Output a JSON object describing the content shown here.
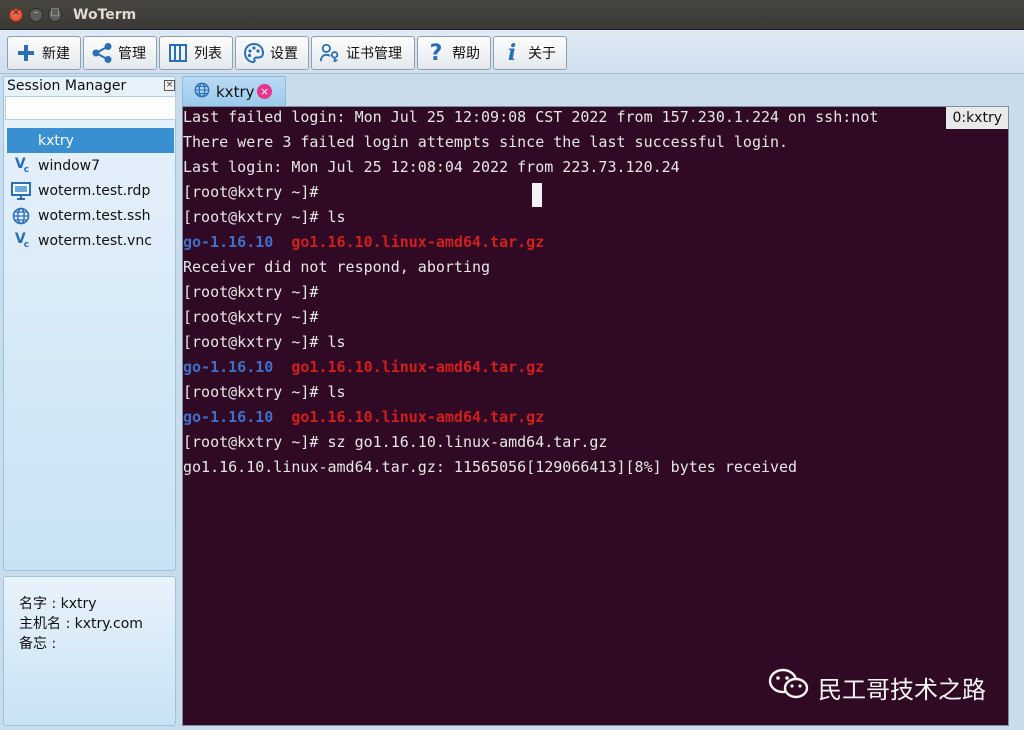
{
  "window": {
    "title": "WoTerm"
  },
  "toolbar": {
    "buttons": [
      {
        "label": "新建",
        "icon": "plus-icon"
      },
      {
        "label": "管理",
        "icon": "share-icon"
      },
      {
        "label": "列表",
        "icon": "list-panel-icon"
      },
      {
        "label": "设置",
        "icon": "palette-icon"
      },
      {
        "label": "证书管理",
        "icon": "key-user-icon"
      },
      {
        "label": "帮助",
        "icon": "question-icon"
      },
      {
        "label": "关于",
        "icon": "info-icon"
      }
    ]
  },
  "session_manager": {
    "title": "Session Manager",
    "search_value": "",
    "items": [
      {
        "label": "kxtry",
        "icon": "none",
        "selected": true
      },
      {
        "label": "window7",
        "icon": "vnc-icon"
      },
      {
        "label": "woterm.test.rdp",
        "icon": "rdp-monitor-icon"
      },
      {
        "label": "woterm.test.ssh",
        "icon": "globe-icon"
      },
      {
        "label": "woterm.test.vnc",
        "icon": "vnc-icon"
      }
    ]
  },
  "info": {
    "name_label": "名字 : kxtry",
    "host_label": "主机名 : kxtry.com",
    "note_label": "备忘 :"
  },
  "tab": {
    "label": "kxtry"
  },
  "terminal": {
    "tag": "0:kxtry",
    "lines": [
      {
        "text": "Last failed login: Mon Jul 25 12:09:08 CST 2022 from 157.230.1.224 on ssh:not"
      },
      {
        "text": "There were 3 failed login attempts since the last successful login."
      },
      {
        "text": "Last login: Mon Jul 25 12:08:04 2022 from 223.73.120.24"
      },
      {
        "text": "[root@kxtry ~]#"
      },
      {
        "text": "[root@kxtry ~]# ls"
      },
      {
        "dir": "go-1.16.10",
        "file": "go1.16.10.linux-amd64.tar.gz"
      },
      {
        "text": "Receiver did not respond, aborting"
      },
      {
        "text": "[root@kxtry ~]#"
      },
      {
        "text": "[root@kxtry ~]#"
      },
      {
        "text": "[root@kxtry ~]# ls"
      },
      {
        "dir": "go-1.16.10",
        "file": "go1.16.10.linux-amd64.tar.gz"
      },
      {
        "text": "[root@kxtry ~]# ls"
      },
      {
        "dir": "go-1.16.10",
        "file": "go1.16.10.linux-amd64.tar.gz"
      },
      {
        "text": "[root@kxtry ~]# sz go1.16.10.linux-amd64.tar.gz"
      },
      {
        "text": "go1.16.10.linux-amd64.tar.gz: 11565056[129066413][8%] bytes received"
      }
    ],
    "watermark": "民工哥技术之路",
    "colors": {
      "background": "#300a24",
      "directory": "#3f6fc9",
      "archive": "#d01f1f"
    }
  }
}
